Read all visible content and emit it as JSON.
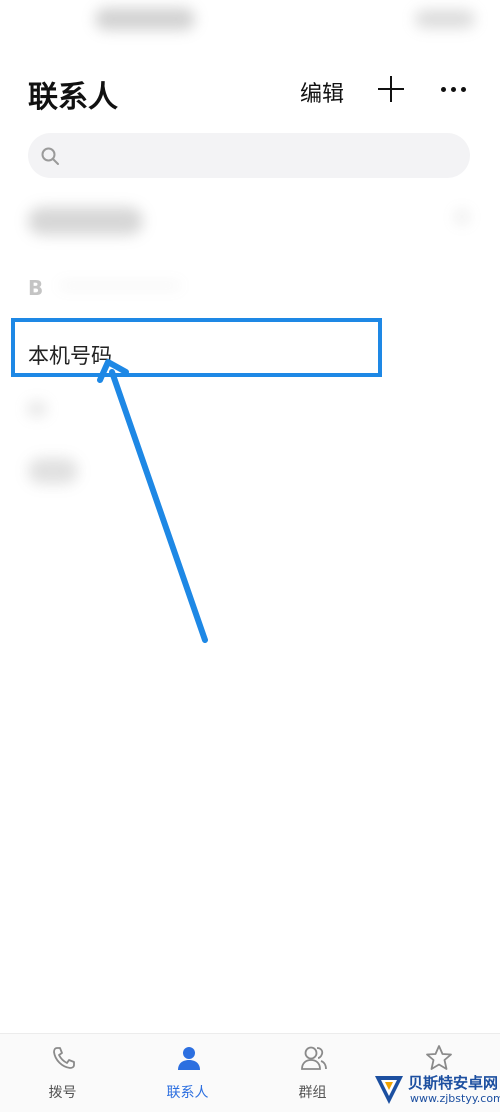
{
  "header": {
    "title": "联系人",
    "edit_label": "编辑"
  },
  "search": {
    "placeholder": ""
  },
  "contacts": {
    "section_b": "B",
    "my_number_label": "本机号码"
  },
  "nav": {
    "items": [
      {
        "label": "拨号",
        "icon": "phone-icon"
      },
      {
        "label": "联系人",
        "icon": "person-icon",
        "active": true
      },
      {
        "label": "群组",
        "icon": "group-icon"
      },
      {
        "label": "",
        "icon": "star-icon"
      }
    ]
  },
  "watermark": {
    "name": "贝斯特安卓网",
    "url": "www.zjbstyy.com"
  },
  "colors": {
    "accent": "#2c6fe0",
    "highlight": "#1e88e5"
  }
}
